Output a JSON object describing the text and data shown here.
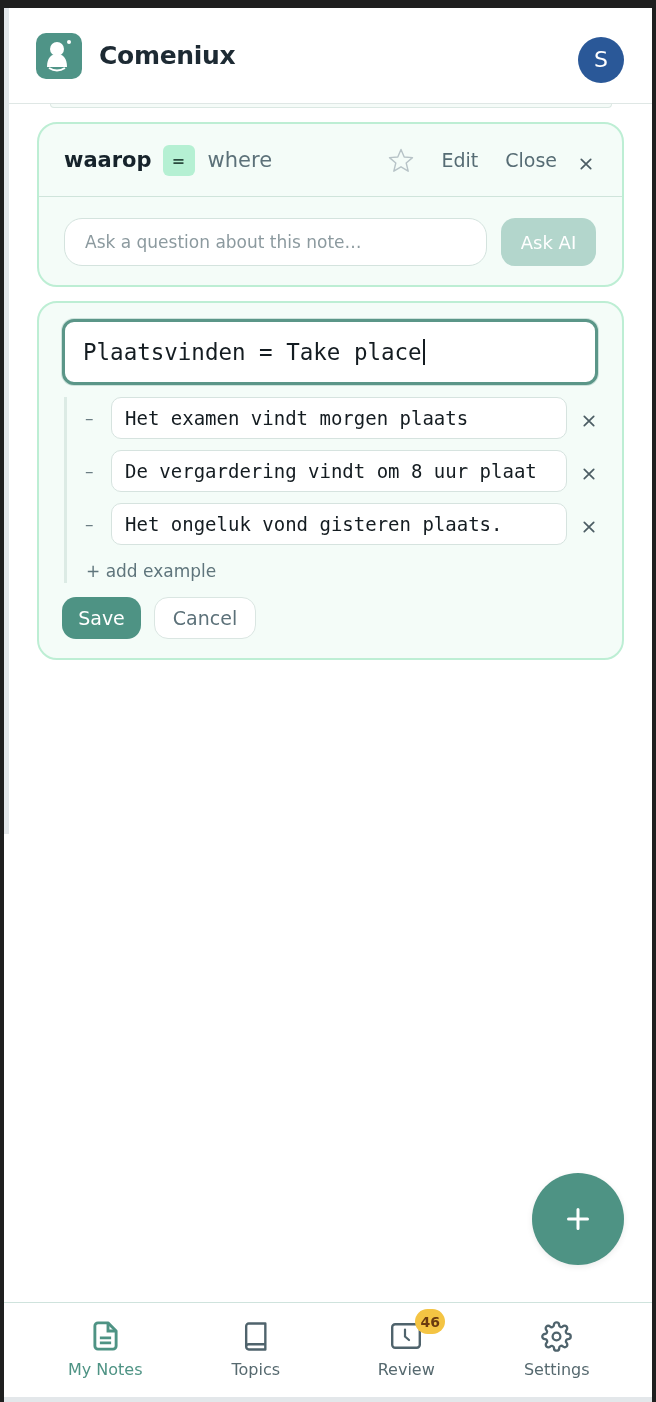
{
  "header": {
    "app_name": "Comeniux",
    "avatar_initial": "S"
  },
  "note_card": {
    "term": "waarop",
    "separator": "=",
    "translation": "where",
    "starred": false,
    "actions": [
      {
        "label": "Edit"
      },
      {
        "label": "Close"
      }
    ],
    "ask_field": {
      "placeholder": "Ask a question about this note…"
    },
    "ask_button": {
      "label": "Ask AI",
      "disabled": true
    }
  },
  "edit_card": {
    "title_field": {
      "value": "Plaatsvinden = Take place",
      "focused": true
    },
    "examples": [
      {
        "bullet": "–",
        "value": "Het examen vindt morgen plaats"
      },
      {
        "bullet": "–",
        "value": "De vergardering vindt om 8 uur plaat"
      },
      {
        "bullet": "–",
        "value": "Het ongeluk vond gisteren plaats."
      }
    ],
    "add_example": "+ add example",
    "buttons": [
      {
        "label": "Save",
        "kind": "primary"
      },
      {
        "label": "Cancel",
        "kind": "secondary"
      }
    ]
  },
  "nav": [
    {
      "label": "My Notes",
      "selected": true
    },
    {
      "label": "Topics",
      "selected": false
    },
    {
      "label": "Review",
      "selected": false,
      "badge": "46"
    },
    {
      "label": "Settings",
      "selected": false
    }
  ]
}
